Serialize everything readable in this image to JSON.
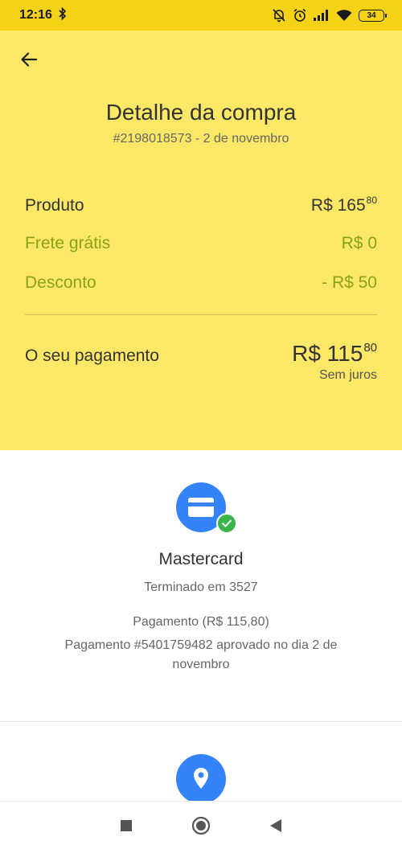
{
  "status_bar": {
    "time": "12:16",
    "battery": "34",
    "icons": [
      "bluetooth-icon",
      "notifications-off-icon",
      "alarm-icon",
      "signal-icon",
      "wifi-icon",
      "battery-icon"
    ]
  },
  "header": {
    "title": "Detalhe da compra",
    "subtitle": "#2198018573 - 2 de novembro"
  },
  "summary": {
    "product": {
      "label": "Produto",
      "amount": "R$ 165",
      "cents": "80"
    },
    "shipping": {
      "label": "Frete grátis",
      "amount": "R$ 0"
    },
    "discount": {
      "label": "Desconto",
      "amount": "- R$ 50"
    },
    "total": {
      "label": "O seu pagamento",
      "amount": "R$ 115",
      "cents": "80",
      "note": "Sem juros"
    }
  },
  "payment": {
    "brand": "Mastercard",
    "ending": "Terminado em 3527",
    "amount_line": "Pagamento (R$ 115,80)",
    "detail_line": "Pagamento #5401759482 aprovado no dia 2 de novembro"
  },
  "colors": {
    "status_bar": "#f3d217",
    "header_bg": "#fde767",
    "green_text": "#8aa316",
    "accent_blue": "#3483fa",
    "check_green": "#39b54a"
  },
  "nav": [
    "recents-square-icon",
    "home-circle-icon",
    "back-triangle-icon"
  ]
}
